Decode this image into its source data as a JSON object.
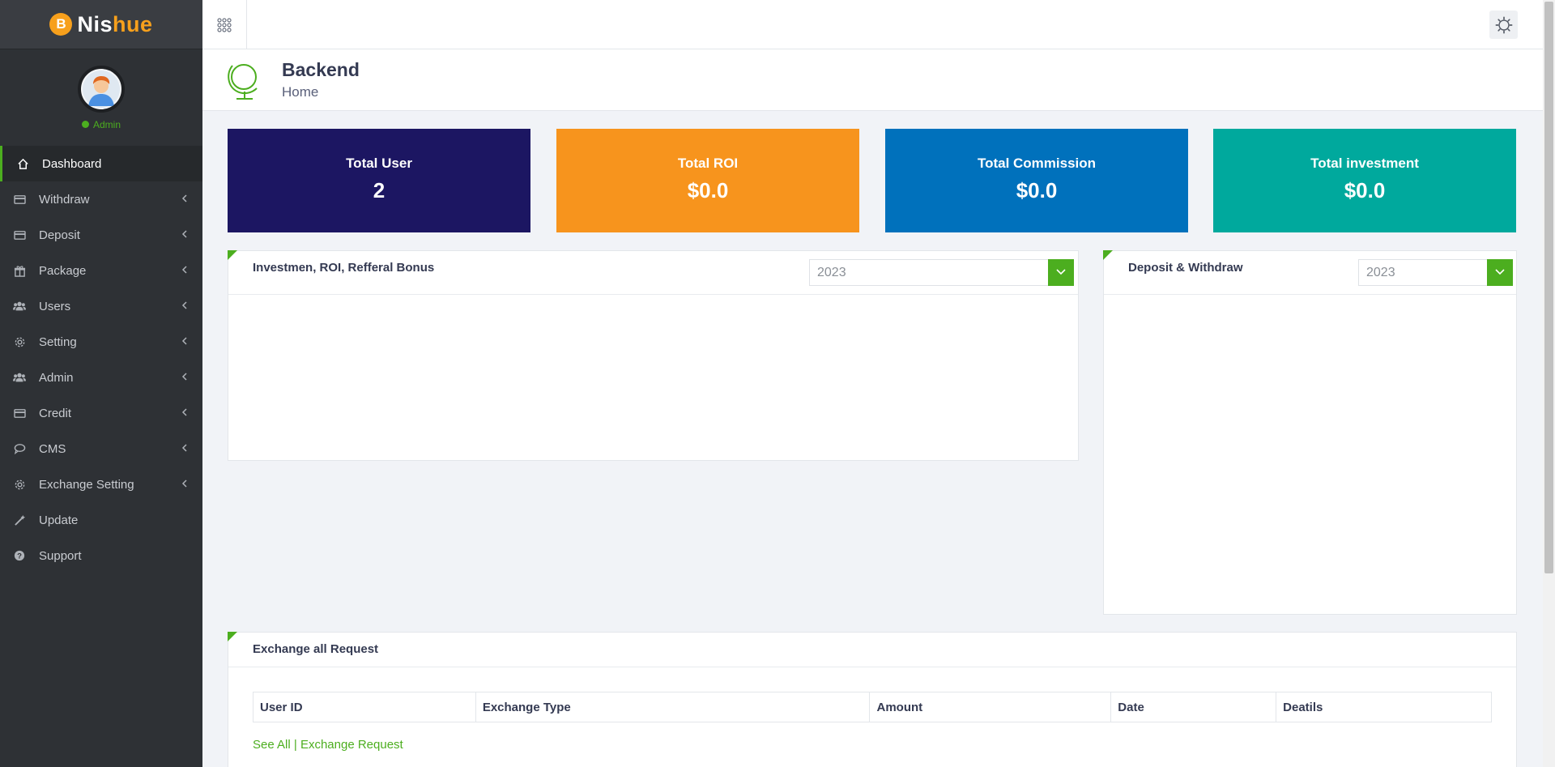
{
  "brand": {
    "coin": "B",
    "name_a": "Nis",
    "name_b": "hue"
  },
  "profile": {
    "role": "Admin"
  },
  "sidebar": {
    "items": [
      {
        "label": "Dashboard",
        "icon": "home-icon",
        "active": true
      },
      {
        "label": "Withdraw",
        "icon": "card-icon"
      },
      {
        "label": "Deposit",
        "icon": "card-icon"
      },
      {
        "label": "Package",
        "icon": "gift-icon"
      },
      {
        "label": "Users",
        "icon": "users-icon"
      },
      {
        "label": "Setting",
        "icon": "gear-icon"
      },
      {
        "label": "Admin",
        "icon": "users-icon"
      },
      {
        "label": "Credit",
        "icon": "card-icon"
      },
      {
        "label": "CMS",
        "icon": "chat-icon"
      },
      {
        "label": "Exchange Setting",
        "icon": "gear-icon"
      },
      {
        "label": "Update",
        "icon": "wand-icon"
      },
      {
        "label": "Support",
        "icon": "help-icon"
      }
    ]
  },
  "header": {
    "title": "Backend",
    "subtitle": "Home"
  },
  "stats": [
    {
      "label": "Total User",
      "value": "2",
      "color": "#1c1662"
    },
    {
      "label": "Total ROI",
      "value": "$0.0",
      "color": "#f7941d"
    },
    {
      "label": "Total Commission",
      "value": "$0.0",
      "color": "#0071bc"
    },
    {
      "label": "Total investment",
      "value": "$0.0",
      "color": "#00a99d"
    }
  ],
  "panels": {
    "investment": {
      "title": "Investmen, ROI, Refferal Bonus",
      "year": "2023"
    },
    "deposit": {
      "title": "Deposit & Withdraw",
      "year": "2023"
    },
    "exchange": {
      "title": "Exchange all Request",
      "columns": [
        "User ID",
        "Exchange Type",
        "Amount",
        "Date",
        "Deatils"
      ],
      "link_see_all": "See All",
      "link_separator": "|",
      "link_exchange": "Exchange Request"
    }
  },
  "colors": {
    "accent": "#4cae1f",
    "sidebar": "#2e3135",
    "brand_orange": "#f7a01c"
  }
}
